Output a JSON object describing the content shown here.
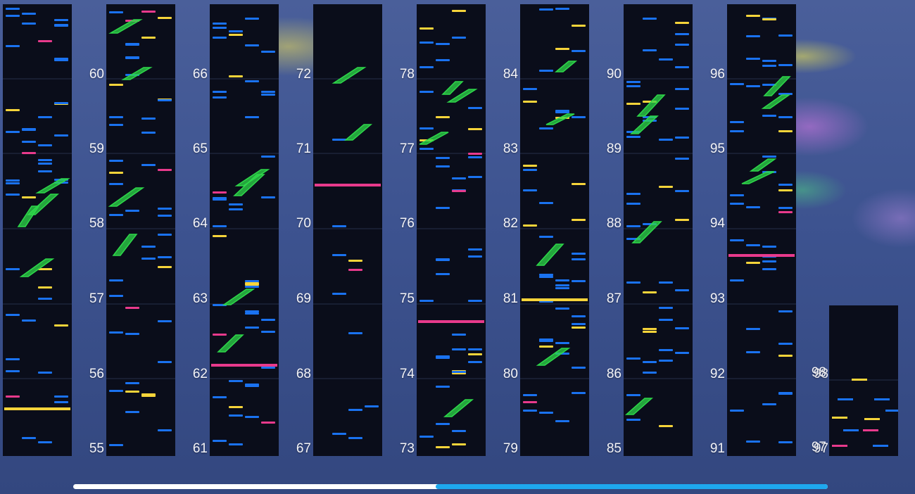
{
  "chart": {
    "measures": [
      "55",
      "56",
      "57",
      "58",
      "59",
      "60",
      "61",
      "62",
      "63",
      "64",
      "65",
      "66",
      "67",
      "68",
      "69",
      "70",
      "71",
      "72",
      "73",
      "74",
      "75",
      "76",
      "77",
      "78",
      "79",
      "80",
      "81",
      "82",
      "83",
      "84",
      "85",
      "86",
      "87",
      "88",
      "89",
      "90",
      "91",
      "92",
      "93",
      "94",
      "95",
      "96",
      "97",
      "98"
    ]
  },
  "colors": {
    "tap": "#1a72f0",
    "ex": "#f6d43a",
    "flick": "#e83a8c",
    "slide": "#2ed84a",
    "background": "#0a0d1a",
    "scroll_thumb": "#1ea8ee"
  },
  "scroll": {
    "progress": 0.48
  }
}
